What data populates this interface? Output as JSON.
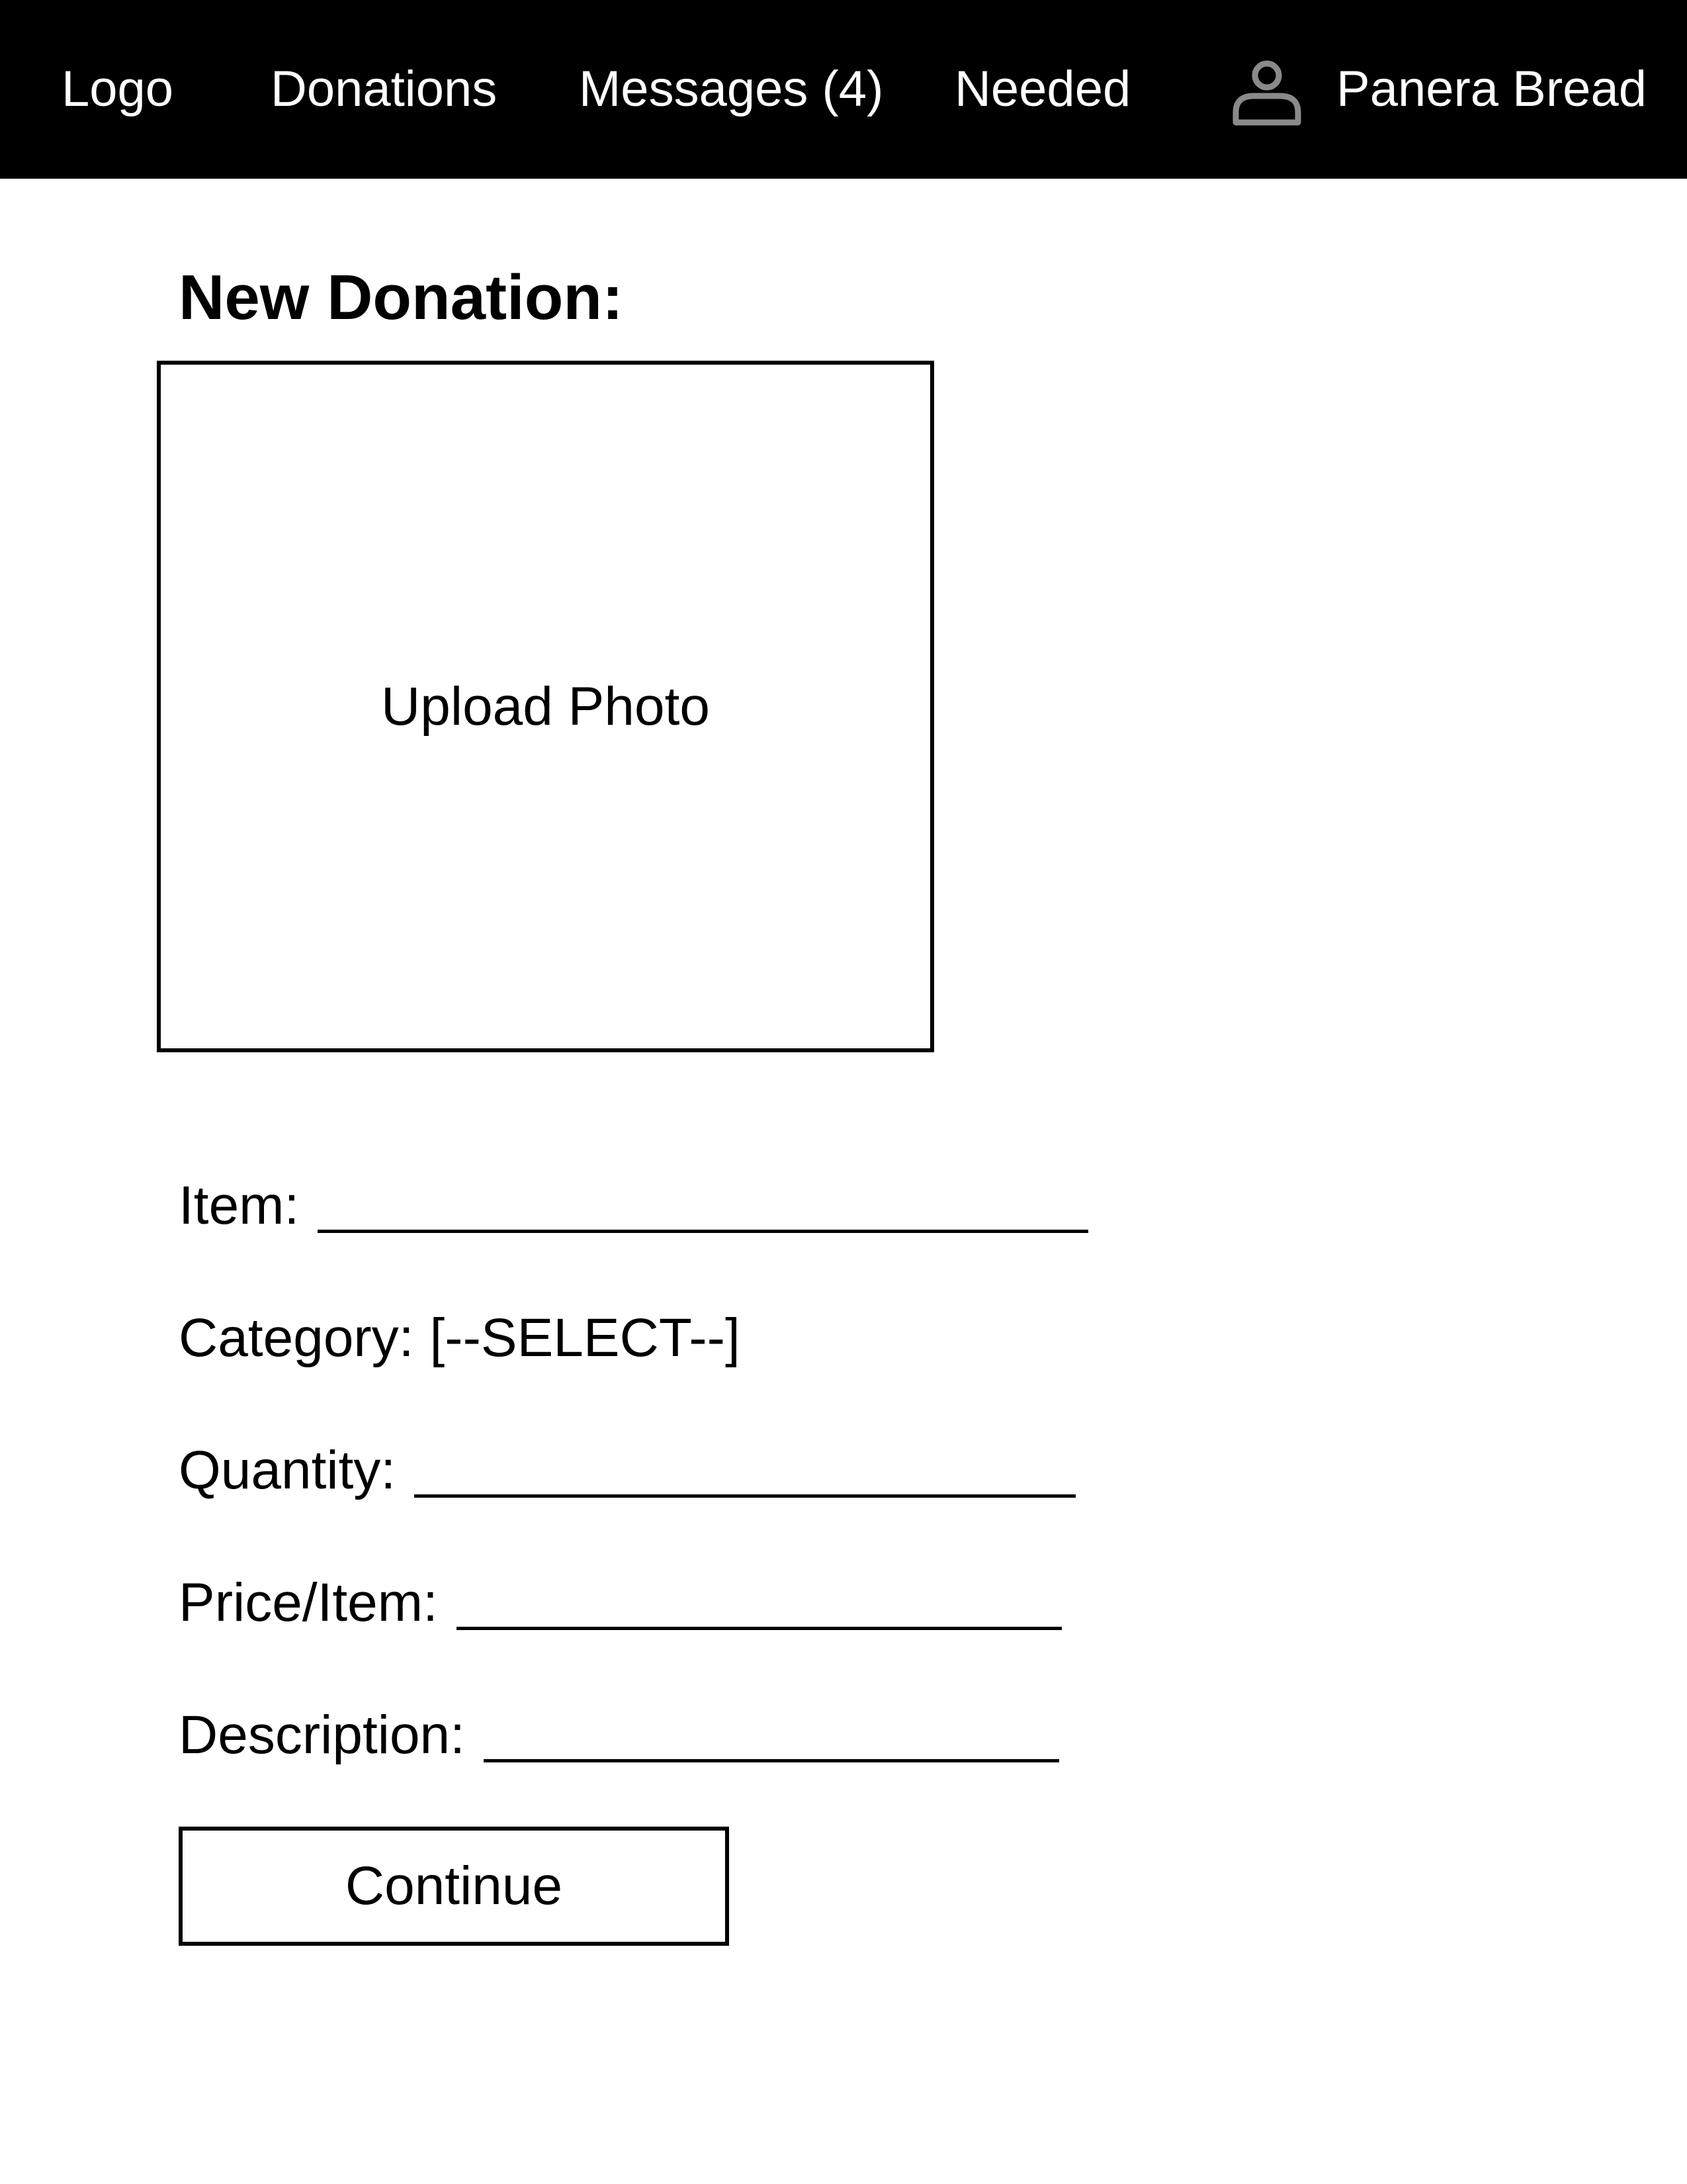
{
  "nav": {
    "logo": "Logo",
    "donations": "Donations",
    "messages": "Messages (4)",
    "needed": "Needed",
    "user_name": "Panera Bread",
    "user_icon": "person-icon"
  },
  "main": {
    "title": "New Donation:",
    "upload_label": "Upload Photo",
    "fields": {
      "item_label": "Item:",
      "category_label": "Category:",
      "category_value": "[--SELECT--]",
      "quantity_label": "Quantity:",
      "price_label": "Price/Item:",
      "description_label": "Description:"
    },
    "continue_label": "Continue"
  },
  "colors": {
    "navbar_bg": "#000000",
    "navbar_text": "#ffffff",
    "icon_gray": "#8a8a8a"
  }
}
